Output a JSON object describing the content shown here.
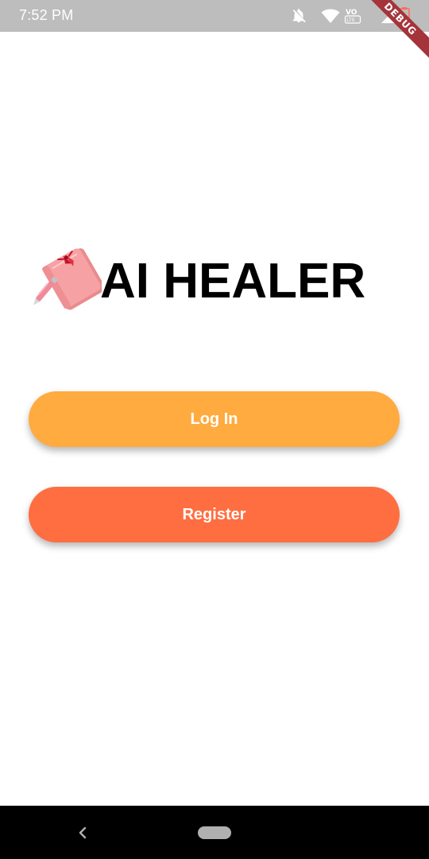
{
  "status_bar": {
    "time": "7:52 PM",
    "icons": [
      "notifications-off-icon",
      "wifi-icon",
      "volte-icon",
      "signal-icon",
      "battery-charging-icon"
    ],
    "volte_top": "VO",
    "volte_bottom": "LTE"
  },
  "debug_banner": "DEBUG",
  "app": {
    "logo_icon": "book-with-pen-icon",
    "title": "AI HEALER"
  },
  "buttons": {
    "login_label": "Log In",
    "register_label": "Register"
  },
  "colors": {
    "login": "#ffab40",
    "register": "#ff6e40",
    "status_bar": "#bdbdbd",
    "debug_ribbon": "#a5343a"
  },
  "nav_bar": {
    "icons": [
      "back-icon",
      "home-pill-icon"
    ]
  }
}
